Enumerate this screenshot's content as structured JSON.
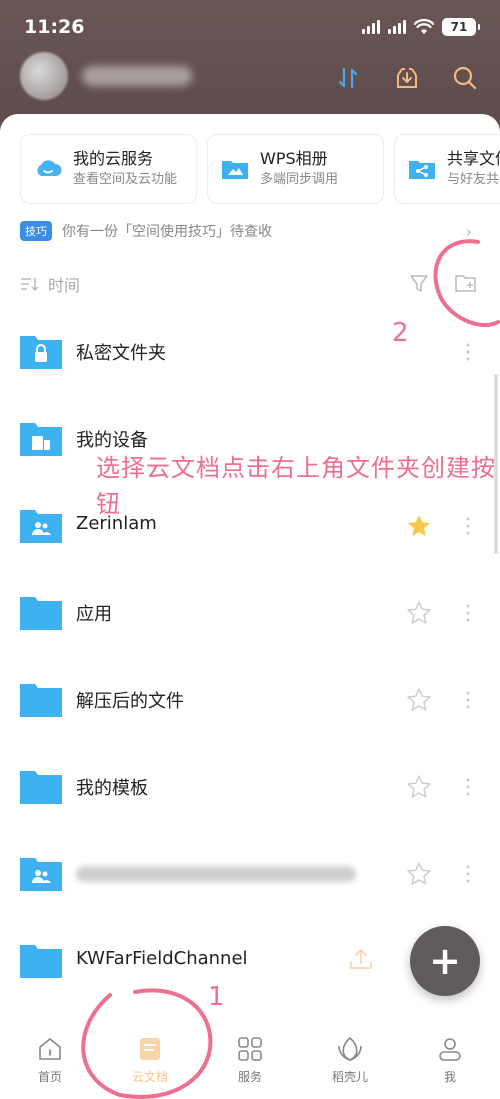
{
  "status_bar": {
    "time": "11:26",
    "battery": "71"
  },
  "header": {
    "icons": [
      "sort-transfer-icon",
      "download-icon",
      "search-icon"
    ]
  },
  "services": [
    {
      "title": "我的云服务",
      "subtitle": "查看空间及云功能",
      "icon": "cloud-icon"
    },
    {
      "title": "WPS相册",
      "subtitle": "多端同步调用",
      "icon": "photo-folder-icon"
    },
    {
      "title": "共享文件夹",
      "subtitle": "与好友共享",
      "icon": "share-folder-icon"
    }
  ],
  "tip": {
    "badge": "技巧",
    "text": "你有一份「空间使用技巧」待查收"
  },
  "sort": {
    "label": "时间"
  },
  "files": [
    {
      "name": "私密文件夹",
      "icon": "lock-folder-icon",
      "starred": null
    },
    {
      "name": "我的设备",
      "icon": "device-folder-icon",
      "starred": null
    },
    {
      "name": "Zerinlam",
      "icon": "people-folder-icon",
      "starred": true
    },
    {
      "name": "应用",
      "icon": "folder-icon",
      "starred": false
    },
    {
      "name": "解压后的文件",
      "icon": "folder-icon",
      "starred": false
    },
    {
      "name": "我的模板",
      "icon": "folder-icon",
      "starred": false
    },
    {
      "name": "",
      "icon": "people-folder-icon",
      "starred": false
    },
    {
      "name": "KWFarFieldChannel",
      "icon": "folder-icon",
      "starred": null
    }
  ],
  "fab": {
    "label": "+"
  },
  "tabs": [
    {
      "label": "首页",
      "icon": "home-icon"
    },
    {
      "label": "云文档",
      "icon": "cloud-doc-icon"
    },
    {
      "label": "服务",
      "icon": "grid-icon"
    },
    {
      "label": "稻壳儿",
      "icon": "leaf-icon"
    },
    {
      "label": "我",
      "icon": "person-icon"
    }
  ],
  "annotation": {
    "instruction": "选择云文档点击右上角文件夹创建按钮",
    "step1": "1",
    "step2": "2",
    "color": "#ee6f8f"
  },
  "colors": {
    "accent": "#3a8ee6",
    "folder": "#3db1f2",
    "star": "#f7c948",
    "header_bg": "#5d4b4b"
  }
}
